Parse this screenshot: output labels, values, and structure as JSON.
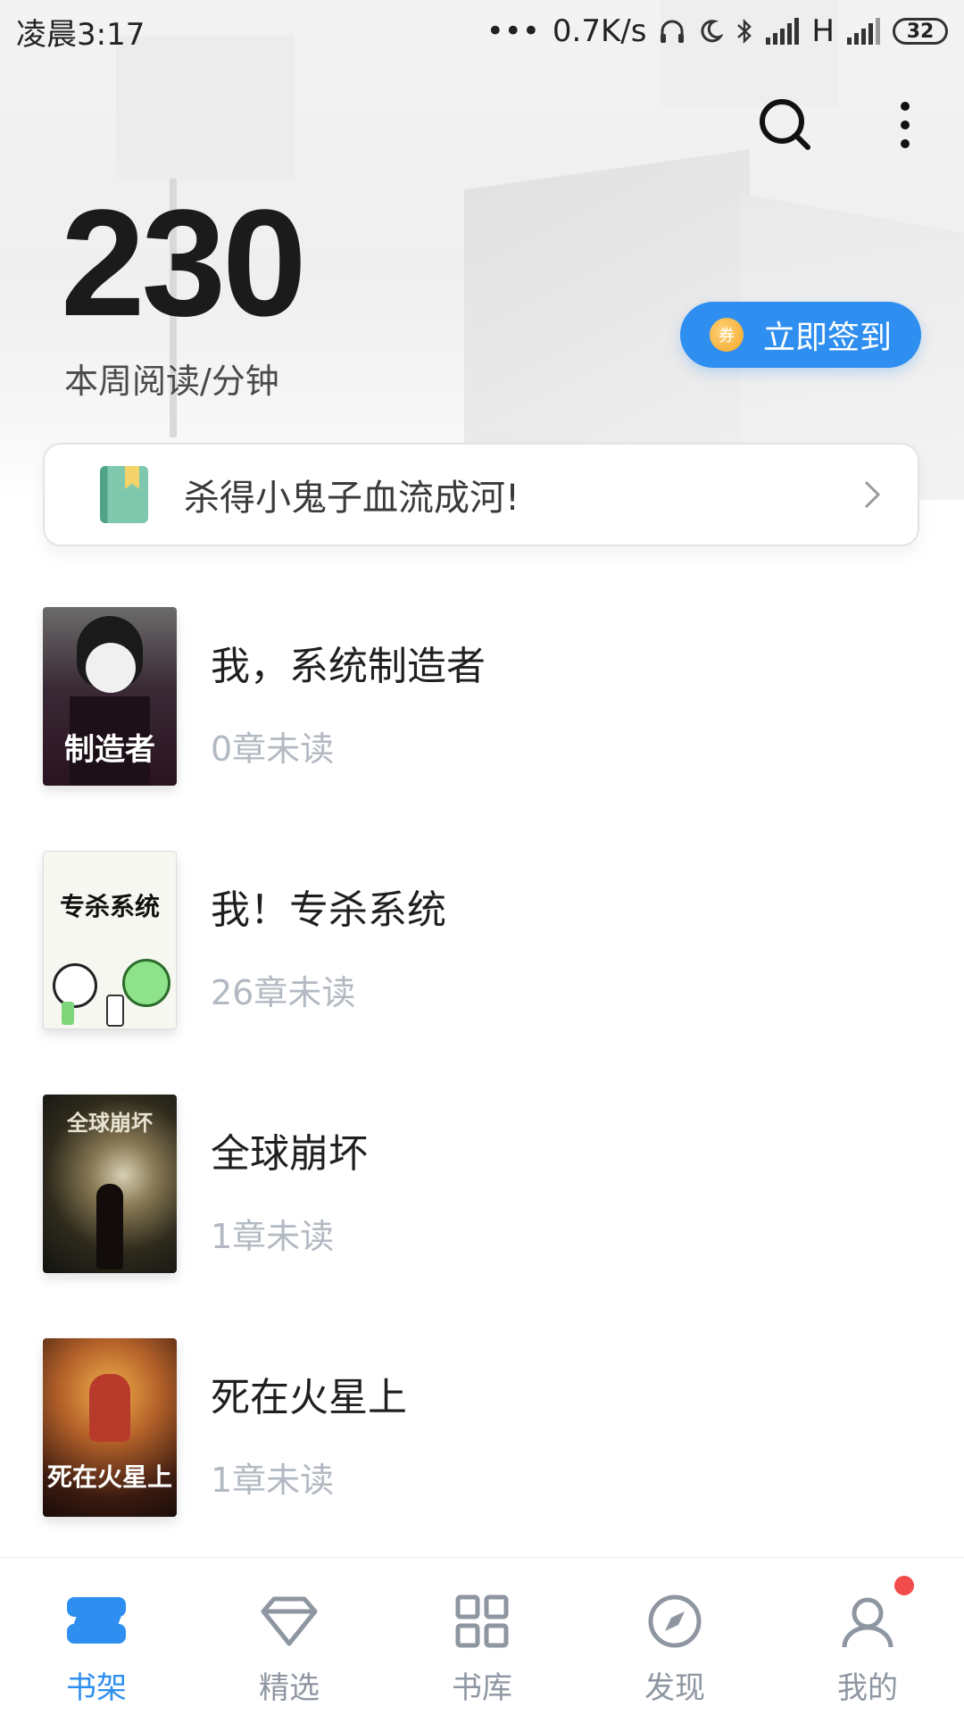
{
  "status_bar": {
    "time": "凌晨3:17",
    "network_speed": "0.7K/s",
    "network_type": "H",
    "battery": "32"
  },
  "stats": {
    "value": "230",
    "label": "本周阅读/分钟"
  },
  "checkin": {
    "coin_glyph": "券",
    "label": "立即签到"
  },
  "recommendation": {
    "text": "杀得小鬼子血流成河!"
  },
  "books": [
    {
      "title": "我，系统制造者",
      "unread": "0章未读"
    },
    {
      "title": "我！专杀系统",
      "unread": "26章未读"
    },
    {
      "title": "全球崩坏",
      "unread": "1章未读"
    },
    {
      "title": "死在火星上",
      "unread": "1章未读"
    }
  ],
  "bottom_nav": {
    "items": [
      {
        "label": "书架",
        "icon": "bookshelf-icon",
        "active": true
      },
      {
        "label": "精选",
        "icon": "diamond-icon",
        "active": false
      },
      {
        "label": "书库",
        "icon": "grid-icon",
        "active": false
      },
      {
        "label": "发现",
        "icon": "compass-icon",
        "active": false
      },
      {
        "label": "我的",
        "icon": "user-icon",
        "active": false
      }
    ]
  },
  "colors": {
    "accent": "#2f8ff0",
    "muted_text": "#b3b9c2",
    "badge": "#f24b4b"
  }
}
